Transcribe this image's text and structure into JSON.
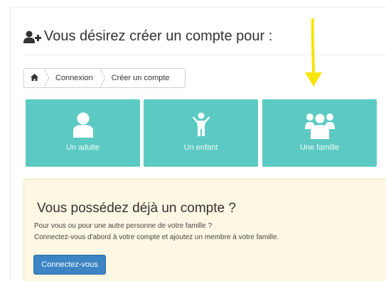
{
  "header": {
    "title": "Vous désirez créer un compte pour :",
    "icon": "user-plus-icon"
  },
  "breadcrumb": {
    "home_icon": "home-icon",
    "items": [
      {
        "label": "Connexion"
      },
      {
        "label": "Créer un compte"
      }
    ]
  },
  "annotation": {
    "arrow_color": "#f5e50a",
    "arrow_icon": "down-arrow-icon"
  },
  "tiles": [
    {
      "label": "Un adulte",
      "icon": "adult-icon"
    },
    {
      "label": "Un enfant",
      "icon": "child-icon"
    },
    {
      "label": "Une famille",
      "icon": "family-icon"
    }
  ],
  "existing_account": {
    "title": "Vous possédez déjà un compte ?",
    "line1": "Pour vous ou pour une autre personne de votre famille ?",
    "line2": "Connectez-vous d'abord à votre compte et ajoutez un membre à votre famille.",
    "button_label": "Connectez-vous"
  },
  "colors": {
    "tile": "#5ccac2",
    "alert_bg": "#fdf7e4",
    "button": "#3c84c4",
    "arrow": "#f5e50a"
  }
}
